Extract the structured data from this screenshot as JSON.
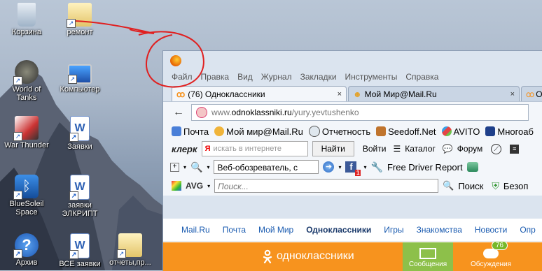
{
  "desktop": {
    "icons": [
      {
        "label": "Корзина",
        "icon": "recycle-bin-icon"
      },
      {
        "label": "ремонт",
        "icon": "folder-icon"
      },
      {
        "label": "World of Tanks",
        "icon": "world-of-tanks-icon"
      },
      {
        "label": "Компьютер",
        "icon": "computer-icon"
      },
      {
        "label": "War Thunder",
        "icon": "war-thunder-icon"
      },
      {
        "label": "Заявки",
        "icon": "word-document-icon"
      },
      {
        "label": "BlueSoleil Space",
        "icon": "bluetooth-icon"
      },
      {
        "label": "заявки ЭЛКРИПТ",
        "icon": "word-document-icon"
      },
      {
        "label": "Архив",
        "icon": "help-icon"
      },
      {
        "label": "ВСЕ заявки",
        "icon": "word-document-icon"
      },
      {
        "label": "отчеты,пр...",
        "icon": "folder-icon"
      }
    ]
  },
  "browser": {
    "menu": [
      "Файл",
      "Правка",
      "Вид",
      "Журнал",
      "Закладки",
      "Инструменты",
      "Справка"
    ],
    "tabs": [
      {
        "label": "(76) Одноклассники",
        "close": "×"
      },
      {
        "label": "Мой Мир@Mail.Ru",
        "close": "×"
      },
      {
        "label": "Op",
        "close": ""
      }
    ],
    "url": {
      "prefix": "www.",
      "domain": "odnoklassniki.ru",
      "path": "/yury.yevtushenko"
    },
    "bookmarks": [
      "Почта",
      "Мой мир@Mail.Ru",
      "Отчетность",
      "Seedoff.Net",
      "AVITO",
      "Многоаб"
    ],
    "klerk": {
      "logo": "клерк",
      "search_placeholder": "искать в интернете",
      "search_button": "Найти",
      "links": [
        "Войти",
        "Каталог",
        "Форум"
      ]
    },
    "toolbar2": {
      "search_select": "Веб-обозреватель, с",
      "fb_badge": "1",
      "driver": "Free Driver Report"
    },
    "avg": {
      "logo": "AVG",
      "search_placeholder": "Поиск...",
      "search_button": "Поиск",
      "safe": "Безоп"
    }
  },
  "page": {
    "mailnav": [
      "Mail.Ru",
      "Почта",
      "Мой Мир",
      "Одноклассники",
      "Игры",
      "Знакомства",
      "Новости",
      "Опр"
    ],
    "ok_logo": "одноклассники",
    "messages": "Сообщения",
    "discussions": "Обсуждения",
    "discussions_count": "76"
  },
  "colors": {
    "ok_orange": "#f7931e",
    "ok_green": "#8dc04a",
    "annotation": "#e02020"
  }
}
